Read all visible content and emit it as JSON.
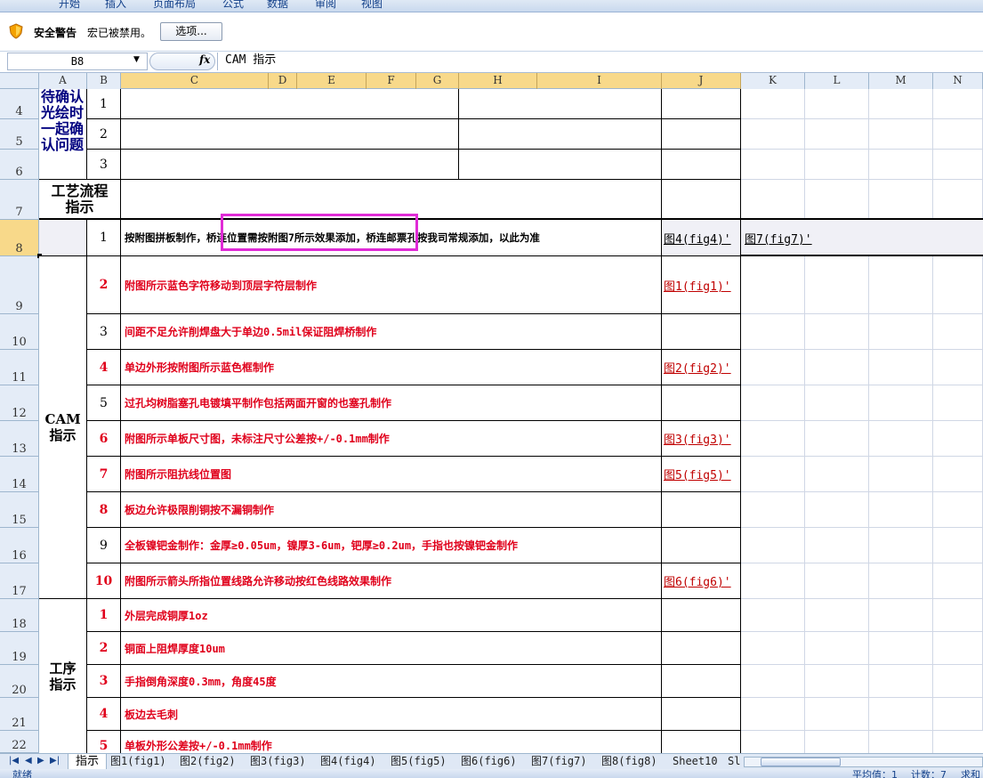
{
  "ribbon": {
    "tabs": [
      "开始",
      "插入",
      "页面布局",
      "公式",
      "数据",
      "审阅",
      "视图"
    ]
  },
  "security": {
    "title": "安全警告",
    "message": "宏已被禁用。",
    "options_button": "选项..."
  },
  "formula_bar": {
    "name_box": "B8",
    "fx": "fx",
    "content": "CAM    指示"
  },
  "columns": [
    "A",
    "B",
    "C",
    "D",
    "E",
    "F",
    "G",
    "H",
    "I",
    "J",
    "K",
    "L",
    "M",
    "N"
  ],
  "rows": {
    "r4": "4",
    "r5": "5",
    "r6": "6",
    "r7": "7",
    "r8": "8",
    "r9": "9",
    "r10": "10",
    "r11": "11",
    "r12": "12",
    "r13": "13",
    "r14": "14",
    "r15": "15",
    "r16": "16",
    "r17": "17",
    "r18": "18",
    "r19": "19",
    "r20": "20",
    "r21": "21",
    "r22": "22"
  },
  "sections": {
    "confirm": "待确认光绘时一起确认问题",
    "process_flow": "工艺流程指示",
    "cam": "CAM指示",
    "procedure": "工序指示"
  },
  "confirm_nums": [
    "1",
    "2",
    "3"
  ],
  "row8": {
    "num": "1",
    "text": "按附图拼板制作，桥连位置需按附图7所示效果添加，桥连邮票孔按我司常规添加，以此为准",
    "link_j": "图4(fig4)'",
    "link_k": "图7(fig7)'"
  },
  "cam_items": [
    {
      "num": "2",
      "text": "附图所示蓝色字符移动到顶层字符层制作",
      "link": "图1(fig1)'"
    },
    {
      "num": "3",
      "text": "间距不足允许削焊盘大于单边0.5mil保证阻焊桥制作",
      "link": ""
    },
    {
      "num": "4",
      "text": "单边外形按附图所示蓝色框制作",
      "link": "图2(fig2)'"
    },
    {
      "num": "5",
      "text": "过孔均树脂塞孔电镀填平制作包括两面开窗的也塞孔制作",
      "link": ""
    },
    {
      "num": "6",
      "text": "附图所示单板尺寸图，未标注尺寸公差按+/-0.1mm制作",
      "link": "图3(fig3)'"
    },
    {
      "num": "7",
      "text": "附图所示阻抗线位置图",
      "link": "图5(fig5)'"
    },
    {
      "num": "8",
      "text": "板边允许极限削铜按不漏铜制作",
      "link": ""
    },
    {
      "num": "9",
      "text": "全板镍钯金制作：金厚≥0.05um，镍厚3-6um，钯厚≥0.2um，手指也按镍钯金制作",
      "link": ""
    },
    {
      "num": "10",
      "text": "附图所示箭头所指位置线路允许移动按红色线路效果制作",
      "link": "图6(fig6)'"
    }
  ],
  "proc_items": [
    {
      "num": "1",
      "text": "外层完成铜厚1oz"
    },
    {
      "num": "2",
      "text": "铜面上阻焊厚度10um"
    },
    {
      "num": "3",
      "text": "手指倒角深度0.3mm，角度45度"
    },
    {
      "num": "4",
      "text": "板边去毛刺"
    },
    {
      "num": "5",
      "text": "单板外形公差按+/-0.1mm制作"
    }
  ],
  "sheet_tabs": [
    "指示",
    "图1(fig1)",
    "图2(fig2)",
    "图3(fig3)",
    "图4(fig4)",
    "图5(fig5)",
    "图6(fig6)",
    "图7(fig7)",
    "图8(fig8)",
    "Sheet10",
    "Sl"
  ],
  "status": {
    "ready": "就绪",
    "average": "平均值：1",
    "count": "计数：7",
    "sum": "求和"
  },
  "colors": {
    "highlight": "#e02bd6",
    "instruction_red": "#e0001b",
    "section_blue": "#00007f"
  }
}
